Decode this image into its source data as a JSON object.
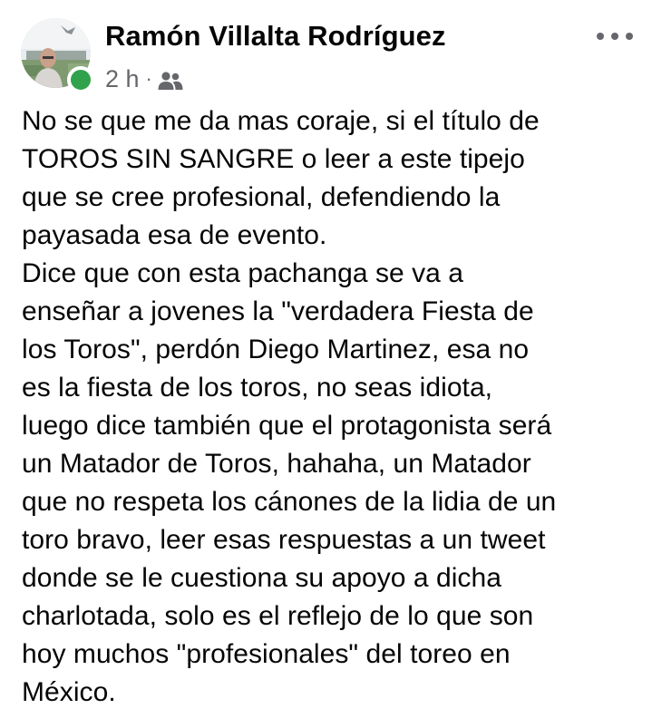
{
  "post": {
    "author": "Ramón Villalta Rodríguez",
    "time": "2 h",
    "separator": "·",
    "audience_icon": "friends-icon",
    "menu_icon": "more-horizontal-icon",
    "online_color": "#31a24c",
    "paragraphs": [
      "No se que me da mas coraje, si el título de\nTOROS SIN SANGRE o leer a este tipejo\nque se cree profesional, defendiendo la\npayasada esa de evento.",
      "Dice que con esta pachanga se va a\nenseñar a jovenes la \"verdadera Fiesta de\nlos Toros\", perdón Diego Martinez, esa no\nes la fiesta de los toros, no seas idiota,\nluego dice también que el protagonista será\nun Matador de Toros, hahaha, un Matador\nque no respeta los cánones de la lidia de un\ntoro bravo, leer esas respuestas a un tweet\ndonde se le cuestiona su apoyo a dicha\ncharlotada, solo es el reflejo de lo que son\nhoy muchos \"profesionales\" del toreo en\nMéxico."
    ]
  }
}
